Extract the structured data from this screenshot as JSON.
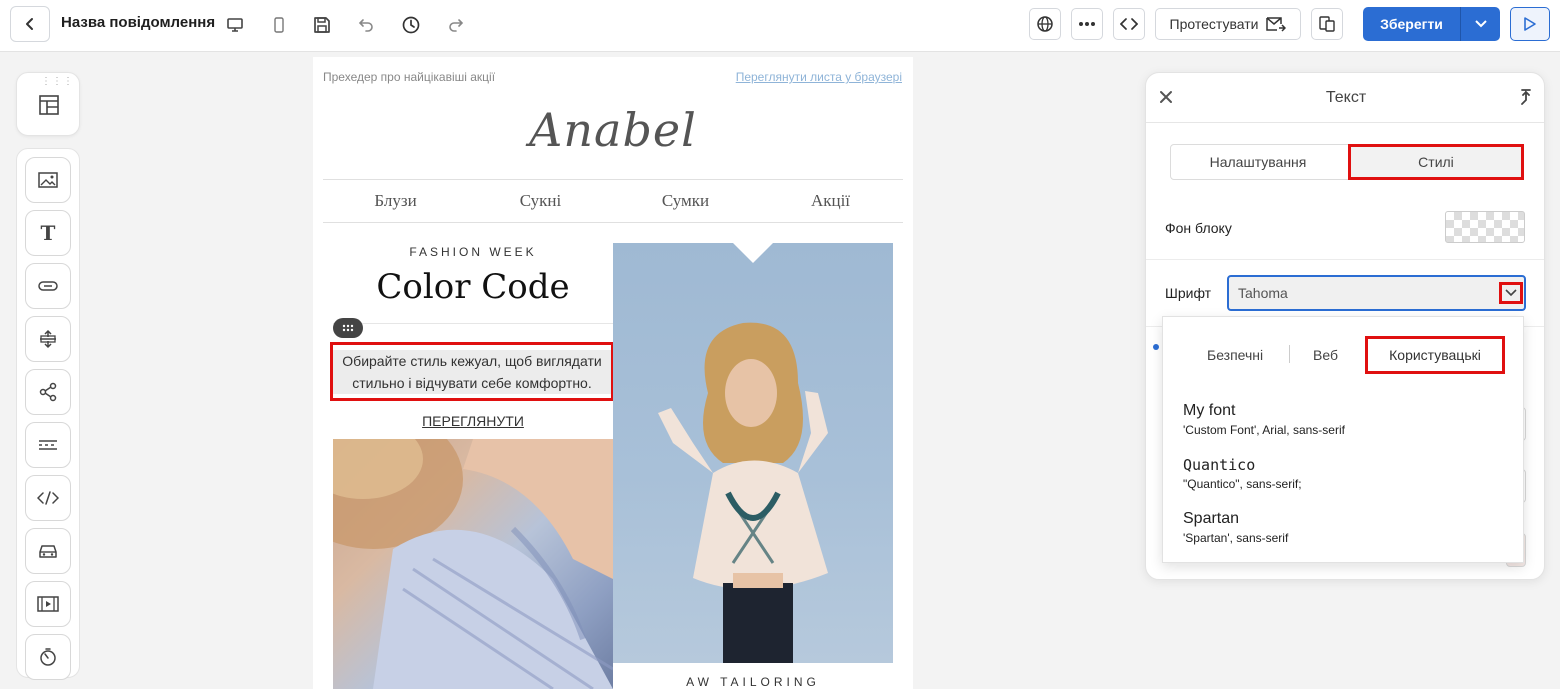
{
  "header": {
    "title": "Назва повідомлення",
    "test_label": "Протестувати",
    "save_label": "Зберегти"
  },
  "email": {
    "preheader": "Прехедер про найцікавіші акції",
    "browser_link": "Переглянути листа у браузері",
    "logo": "Anabel",
    "nav": [
      "Блузи",
      "Сукні",
      "Сумки",
      "Акції"
    ],
    "fashion_week": "FASHION WEEK",
    "headline": "Color Code",
    "body_text": "Обирайте стиль кежуал, щоб виглядати стильно і відчувати себе комфортно.",
    "cta": "ПЕРЕГЛЯНУТИ",
    "aw_label": "AW TAILORING"
  },
  "panel": {
    "title": "Текст",
    "tabs": [
      "Налаштування",
      "Стилі"
    ],
    "active_tab": "Стилі",
    "bg_label": "Фон блоку",
    "font_label": "Шрифт",
    "font_value": "Tahoma"
  },
  "dropdown": {
    "tabs": [
      "Безпечні",
      "Веб",
      "Користувацькі"
    ],
    "active_tab": "Користувацькі",
    "fonts": [
      {
        "name": "My font",
        "stack": "'Custom Font', Arial, sans-serif"
      },
      {
        "name": "Quantico",
        "stack": "\"Quantico\", sans-serif;"
      },
      {
        "name": "Spartan",
        "stack": "'Spartan', sans-serif"
      }
    ]
  },
  "colors": {
    "accent": "#2b6dd3",
    "highlight": "#e01010"
  }
}
